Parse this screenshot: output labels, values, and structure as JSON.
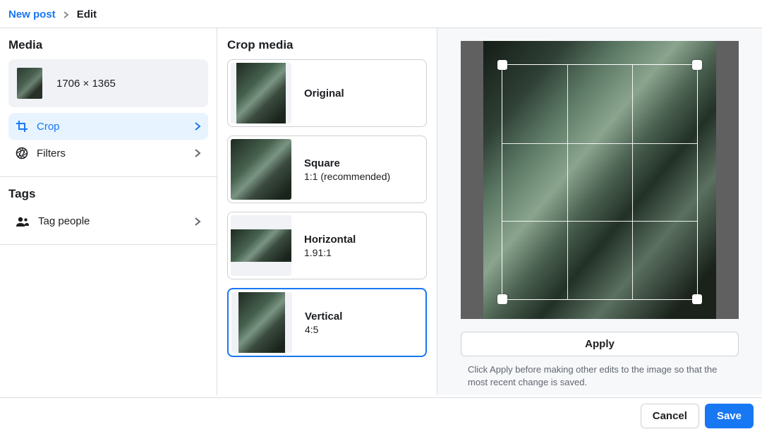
{
  "breadcrumb": {
    "root": "New post",
    "current": "Edit"
  },
  "sidebar": {
    "media_heading": "Media",
    "dimensions": "1706 × 1365",
    "tools": {
      "crop": "Crop",
      "filters": "Filters"
    },
    "tags_heading": "Tags",
    "tag_people": "Tag people"
  },
  "crop": {
    "heading": "Crop media",
    "options": [
      {
        "title": "Original",
        "ratio": ""
      },
      {
        "title": "Square",
        "ratio": "1:1 (recommended)"
      },
      {
        "title": "Horizontal",
        "ratio": "1.91:1"
      },
      {
        "title": "Vertical",
        "ratio": "4:5"
      }
    ],
    "selected": "Vertical"
  },
  "preview": {
    "apply": "Apply",
    "hint": "Click Apply before making other edits to the image so that the most recent change is saved."
  },
  "footer": {
    "cancel": "Cancel",
    "save": "Save"
  }
}
